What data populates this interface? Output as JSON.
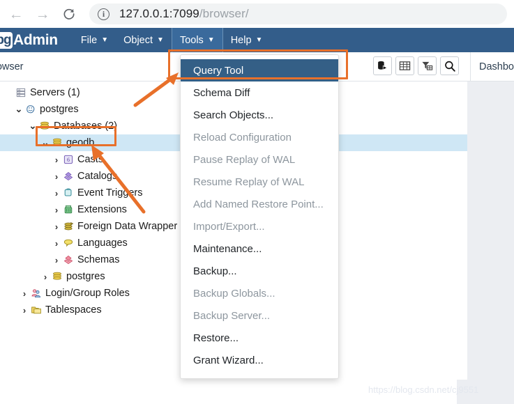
{
  "browser": {
    "back_icon": "back-arrow-icon",
    "forward_icon": "forward-arrow-icon",
    "reload_icon": "reload-icon",
    "info_icon": "site-info-icon",
    "url_host": "127.0.0.1:7099",
    "url_path": "/browser/"
  },
  "app": {
    "logo_badge": "pg",
    "logo_text": "Admin",
    "menus": [
      {
        "label": "File",
        "active": false
      },
      {
        "label": "Object",
        "active": false
      },
      {
        "label": "Tools",
        "active": true
      },
      {
        "label": "Help",
        "active": false
      }
    ],
    "caret": "⌄"
  },
  "subbar": {
    "browser_tab_label": "rowser",
    "dashboard_tab_label": "Dashbo",
    "toolbar_buttons": [
      {
        "name": "add-server-icon",
        "title": "Add New Server"
      },
      {
        "name": "grid-table-icon",
        "title": "View Data"
      },
      {
        "name": "filter-table-icon",
        "title": "Filtered Rows"
      },
      {
        "name": "search-icon",
        "title": "Search Objects"
      }
    ]
  },
  "tools_menu": {
    "items": [
      {
        "label": "Query Tool",
        "disabled": false,
        "highlight": true
      },
      {
        "label": "Schema Diff",
        "disabled": false,
        "highlight": false
      },
      {
        "label": "Search Objects...",
        "disabled": false,
        "highlight": false
      },
      {
        "label": "Reload Configuration",
        "disabled": true,
        "highlight": false
      },
      {
        "label": "Pause Replay of WAL",
        "disabled": true,
        "highlight": false
      },
      {
        "label": "Resume Replay of WAL",
        "disabled": true,
        "highlight": false
      },
      {
        "label": "Add Named Restore Point...",
        "disabled": true,
        "highlight": false
      },
      {
        "label": "Import/Export...",
        "disabled": true,
        "highlight": false
      },
      {
        "label": "Maintenance...",
        "disabled": false,
        "highlight": false
      },
      {
        "label": "Backup...",
        "disabled": false,
        "highlight": false
      },
      {
        "label": "Backup Globals...",
        "disabled": true,
        "highlight": false
      },
      {
        "label": "Backup Server...",
        "disabled": true,
        "highlight": false
      },
      {
        "label": "Restore...",
        "disabled": false,
        "highlight": false
      },
      {
        "label": "Grant Wizard...",
        "disabled": false,
        "highlight": false
      }
    ]
  },
  "tree": {
    "rows": [
      {
        "label": "Servers (1)",
        "indent": 0,
        "twisty": "",
        "icon": "servers-icon",
        "selected": false
      },
      {
        "label": "postgres",
        "indent": 1,
        "twisty": "⌄",
        "icon": "postgresql-elephant-icon",
        "selected": false
      },
      {
        "label": "Databases (2)",
        "indent": 2,
        "twisty": "⌄",
        "icon": "databases-icon",
        "selected": false
      },
      {
        "label": "geodb",
        "indent": 3,
        "twisty": "⌄",
        "icon": "database-icon",
        "selected": true
      },
      {
        "label": "Casts",
        "indent": 4,
        "twisty": "›",
        "icon": "casts-icon",
        "selected": false
      },
      {
        "label": "Catalogs",
        "indent": 4,
        "twisty": "›",
        "icon": "catalogs-icon",
        "selected": false
      },
      {
        "label": "Event Triggers",
        "indent": 4,
        "twisty": "›",
        "icon": "event-triggers-icon",
        "selected": false
      },
      {
        "label": "Extensions",
        "indent": 4,
        "twisty": "›",
        "icon": "extensions-icon",
        "selected": false
      },
      {
        "label": "Foreign Data Wrapper",
        "indent": 4,
        "twisty": "›",
        "icon": "foreign-data-wrappers-icon",
        "selected": false
      },
      {
        "label": "Languages",
        "indent": 4,
        "twisty": "›",
        "icon": "languages-icon",
        "selected": false
      },
      {
        "label": "Schemas",
        "indent": 4,
        "twisty": "›",
        "icon": "schemas-icon",
        "selected": false
      },
      {
        "label": "postgres",
        "indent": 3,
        "twisty": "›",
        "icon": "database-icon",
        "selected": false
      },
      {
        "label": "Login/Group Roles",
        "indent": 2,
        "twisty": "›",
        "icon": "roles-icon",
        "selected": false
      },
      {
        "label": "Tablespaces",
        "indent": 2,
        "twisty": "›",
        "icon": "tablespaces-icon",
        "selected": false
      }
    ]
  },
  "annotations": {
    "color": "#e8702a",
    "box_query_tool": "Query Tool",
    "box_geodb": "geodb",
    "arrow_count": 2
  },
  "watermark": "https://blog.csdn.net/cj9551"
}
